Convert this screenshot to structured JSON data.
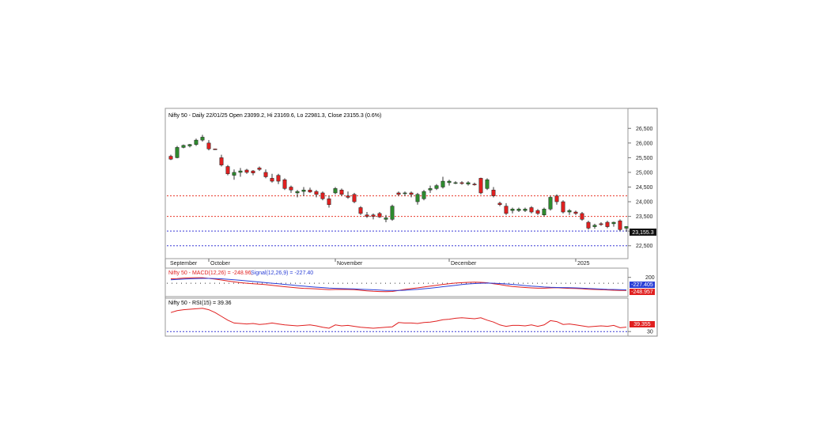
{
  "chart_data": [
    {
      "type": "candlestick",
      "title": "Nifty 50 - Daily 22/01/25 Open 23099.2, Hi 23169.6, Lo 22981.3, Close 23155.3 (0.6%)",
      "last_price_label": "23,155.3",
      "y_ticks": [
        {
          "value": 26500,
          "label": "26,500"
        },
        {
          "value": 26000,
          "label": "26,000"
        },
        {
          "value": 25500,
          "label": "25,500"
        },
        {
          "value": 25000,
          "label": "25,000"
        },
        {
          "value": 24500,
          "label": "24,500"
        },
        {
          "value": 24000,
          "label": "24,000"
        },
        {
          "value": 23500,
          "label": "23,500"
        },
        {
          "value": 23000,
          "label": "23,000"
        },
        {
          "value": 22500,
          "label": "22,500"
        }
      ],
      "ylim": [
        22250,
        26750
      ],
      "horizontal_lines": [
        {
          "value": 24200,
          "color": "#e8392b"
        },
        {
          "value": 23500,
          "color": "#e8392b"
        },
        {
          "value": 23000,
          "color": "#3a3ad6"
        },
        {
          "value": 22500,
          "color": "#3a3ad6"
        }
      ],
      "x_labels": [
        {
          "index": 0,
          "label": "September"
        },
        {
          "index": 6,
          "label": "October"
        },
        {
          "index": 26,
          "label": "November"
        },
        {
          "index": 44,
          "label": "December"
        },
        {
          "index": 64,
          "label": "2025"
        }
      ],
      "bullish_color": "#2e8b2e",
      "bearish_color": "#e02020",
      "candles": [
        {
          "o": 25550,
          "h": 25600,
          "l": 25420,
          "c": 25450
        },
        {
          "o": 25500,
          "h": 25900,
          "l": 25480,
          "c": 25850
        },
        {
          "o": 25850,
          "h": 25950,
          "l": 25820,
          "c": 25920
        },
        {
          "o": 25900,
          "h": 25970,
          "l": 25850,
          "c": 25950
        },
        {
          "o": 25950,
          "h": 26150,
          "l": 25900,
          "c": 26100
        },
        {
          "o": 26100,
          "h": 26280,
          "l": 26050,
          "c": 26200
        },
        {
          "o": 26000,
          "h": 26100,
          "l": 25750,
          "c": 25800
        },
        {
          "o": 25800,
          "h": 25810,
          "l": 25790,
          "c": 25796
        },
        {
          "o": 25500,
          "h": 25600,
          "l": 25200,
          "c": 25250
        },
        {
          "o": 25200,
          "h": 25250,
          "l": 24900,
          "c": 24950
        },
        {
          "o": 24900,
          "h": 25100,
          "l": 24750,
          "c": 25000
        },
        {
          "o": 25000,
          "h": 25150,
          "l": 24850,
          "c": 25050
        },
        {
          "o": 25080,
          "h": 25120,
          "l": 24950,
          "c": 25000
        },
        {
          "o": 25050,
          "h": 25080,
          "l": 24900,
          "c": 24980
        },
        {
          "o": 25150,
          "h": 25200,
          "l": 25050,
          "c": 25100
        },
        {
          "o": 25000,
          "h": 25100,
          "l": 24800,
          "c": 24850
        },
        {
          "o": 24800,
          "h": 24950,
          "l": 24650,
          "c": 24700
        },
        {
          "o": 24900,
          "h": 24950,
          "l": 24600,
          "c": 24700
        },
        {
          "o": 24750,
          "h": 24800,
          "l": 24400,
          "c": 24450
        },
        {
          "o": 24500,
          "h": 24550,
          "l": 24300,
          "c": 24400
        },
        {
          "o": 24300,
          "h": 24400,
          "l": 24150,
          "c": 24350
        },
        {
          "o": 24350,
          "h": 24500,
          "l": 24200,
          "c": 24400
        },
        {
          "o": 24400,
          "h": 24480,
          "l": 24300,
          "c": 24330
        },
        {
          "o": 24350,
          "h": 24400,
          "l": 24150,
          "c": 24250
        },
        {
          "o": 24300,
          "h": 24350,
          "l": 24050,
          "c": 24100
        },
        {
          "o": 24100,
          "h": 24200,
          "l": 23800,
          "c": 23900
        },
        {
          "o": 24300,
          "h": 24500,
          "l": 24250,
          "c": 24450
        },
        {
          "o": 24400,
          "h": 24450,
          "l": 24200,
          "c": 24250
        },
        {
          "o": 24200,
          "h": 24350,
          "l": 24100,
          "c": 24150
        },
        {
          "o": 24250,
          "h": 24300,
          "l": 23950,
          "c": 24000
        },
        {
          "o": 23800,
          "h": 23850,
          "l": 23550,
          "c": 23600
        },
        {
          "o": 23550,
          "h": 23650,
          "l": 23450,
          "c": 23500
        },
        {
          "o": 23550,
          "h": 23600,
          "l": 23400,
          "c": 23500
        },
        {
          "o": 23600,
          "h": 23650,
          "l": 23450,
          "c": 23480
        },
        {
          "o": 23400,
          "h": 23550,
          "l": 23300,
          "c": 23450
        },
        {
          "o": 23400,
          "h": 23900,
          "l": 23350,
          "c": 23850
        },
        {
          "o": 24300,
          "h": 24350,
          "l": 24200,
          "c": 24250
        },
        {
          "o": 24280,
          "h": 24350,
          "l": 24200,
          "c": 24300
        },
        {
          "o": 24300,
          "h": 24350,
          "l": 24150,
          "c": 24250
        },
        {
          "o": 24000,
          "h": 24300,
          "l": 23900,
          "c": 24250
        },
        {
          "o": 24100,
          "h": 24400,
          "l": 24050,
          "c": 24350
        },
        {
          "o": 24400,
          "h": 24550,
          "l": 24300,
          "c": 24450
        },
        {
          "o": 24450,
          "h": 24600,
          "l": 24400,
          "c": 24550
        },
        {
          "o": 24500,
          "h": 24850,
          "l": 24450,
          "c": 24700
        },
        {
          "o": 24650,
          "h": 24750,
          "l": 24550,
          "c": 24700
        },
        {
          "o": 24650,
          "h": 24700,
          "l": 24600,
          "c": 24650
        },
        {
          "o": 24650,
          "h": 24700,
          "l": 24580,
          "c": 24620
        },
        {
          "o": 24600,
          "h": 24700,
          "l": 24550,
          "c": 24650
        },
        {
          "o": 24600,
          "h": 24650,
          "l": 24550,
          "c": 24580
        },
        {
          "o": 24800,
          "h": 24820,
          "l": 24250,
          "c": 24300
        },
        {
          "o": 24450,
          "h": 24800,
          "l": 24400,
          "c": 24750
        },
        {
          "o": 24400,
          "h": 24500,
          "l": 24150,
          "c": 24200
        },
        {
          "o": 23950,
          "h": 24000,
          "l": 23850,
          "c": 23900
        },
        {
          "o": 23850,
          "h": 23950,
          "l": 23550,
          "c": 23600
        },
        {
          "o": 23700,
          "h": 23800,
          "l": 23600,
          "c": 23750
        },
        {
          "o": 23700,
          "h": 23800,
          "l": 23650,
          "c": 23750
        },
        {
          "o": 23700,
          "h": 23800,
          "l": 23650,
          "c": 23750
        },
        {
          "o": 23800,
          "h": 23850,
          "l": 23600,
          "c": 23650
        },
        {
          "o": 23700,
          "h": 23750,
          "l": 23550,
          "c": 23600
        },
        {
          "o": 23550,
          "h": 23800,
          "l": 23500,
          "c": 23750
        },
        {
          "o": 23750,
          "h": 24200,
          "l": 23700,
          "c": 24150
        },
        {
          "o": 24200,
          "h": 24250,
          "l": 23900,
          "c": 24000
        },
        {
          "o": 24000,
          "h": 24050,
          "l": 23600,
          "c": 23650
        },
        {
          "o": 23650,
          "h": 23750,
          "l": 23550,
          "c": 23700
        },
        {
          "o": 23650,
          "h": 23700,
          "l": 23550,
          "c": 23600
        },
        {
          "o": 23600,
          "h": 23650,
          "l": 23350,
          "c": 23400
        },
        {
          "o": 23300,
          "h": 23350,
          "l": 23050,
          "c": 23100
        },
        {
          "o": 23150,
          "h": 23250,
          "l": 23080,
          "c": 23200
        },
        {
          "o": 23250,
          "h": 23300,
          "l": 23180,
          "c": 23220
        },
        {
          "o": 23300,
          "h": 23350,
          "l": 23100,
          "c": 23150
        },
        {
          "o": 23250,
          "h": 23320,
          "l": 23150,
          "c": 23300
        },
        {
          "o": 23350,
          "h": 23400,
          "l": 23000,
          "c": 23050
        },
        {
          "o": 23099.2,
          "h": 23169.6,
          "l": 22981.3,
          "c": 23155.3
        }
      ]
    },
    {
      "type": "line",
      "title": "Nifty 50 - MACD(12,26) = -248.96, Signal(12,26,9) = -227.40",
      "title_parts": {
        "macd": "Nifty 50 - MACD(12,26) = -248.96,",
        "signal": "Signal(12,26,9) = -227.40"
      },
      "y_ticks": [
        {
          "value": 200,
          "label": "200"
        }
      ],
      "ylim": [
        -430,
        300
      ],
      "value_labels": [
        "-227.405",
        "-248.957"
      ],
      "series": [
        {
          "name": "MACD(12,26)",
          "color": "#e02020",
          "values": [
            150,
            160,
            175,
            185,
            190,
            190,
            165,
            140,
            110,
            75,
            45,
            20,
            0,
            -15,
            -30,
            -50,
            -70,
            -95,
            -120,
            -140,
            -160,
            -175,
            -185,
            -195,
            -205,
            -220,
            -215,
            -210,
            -215,
            -220,
            -240,
            -260,
            -275,
            -285,
            -290,
            -280,
            -245,
            -210,
            -185,
            -160,
            -130,
            -100,
            -70,
            -40,
            -15,
            5,
            20,
            30,
            35,
            30,
            15,
            -15,
            -45,
            -80,
            -110,
            -130,
            -145,
            -160,
            -170,
            -170,
            -160,
            -155,
            -165,
            -175,
            -180,
            -190,
            -205,
            -215,
            -220,
            -230,
            -240,
            -245,
            -249
          ]
        },
        {
          "name": "Signal(12,26,9)",
          "color": "#2a3ed6",
          "values": [
            120,
            130,
            140,
            150,
            158,
            165,
            165,
            160,
            150,
            135,
            120,
            100,
            80,
            60,
            40,
            20,
            0,
            -20,
            -40,
            -60,
            -80,
            -100,
            -120,
            -135,
            -150,
            -165,
            -175,
            -185,
            -190,
            -195,
            -205,
            -215,
            -225,
            -235,
            -245,
            -250,
            -250,
            -240,
            -225,
            -210,
            -190,
            -170,
            -145,
            -120,
            -95,
            -70,
            -45,
            -25,
            -10,
            0,
            5,
            0,
            -10,
            -25,
            -40,
            -60,
            -80,
            -100,
            -115,
            -130,
            -140,
            -145,
            -150,
            -155,
            -160,
            -170,
            -180,
            -190,
            -200,
            -210,
            -215,
            -222,
            -227
          ]
        }
      ]
    },
    {
      "type": "line",
      "title": "Nifty 50 - RSI(15) = 39.36",
      "y_ticks": [
        {
          "value": 30,
          "label": "30"
        }
      ],
      "ylim": [
        27,
        82
      ],
      "horizontal_lines": [
        {
          "value": 30,
          "color": "#3a3ad6"
        }
      ],
      "value_label": "39.355",
      "series": [
        {
          "name": "RSI(15)",
          "color": "#e02020",
          "values": [
            70,
            74,
            76,
            77,
            78,
            79,
            76,
            70,
            62,
            54,
            48,
            47,
            46,
            47,
            45,
            46,
            48,
            46,
            44,
            43,
            42,
            43,
            44,
            42,
            39,
            37,
            44,
            42,
            43,
            41,
            39,
            38,
            37,
            38,
            39,
            40,
            49,
            48,
            48,
            47,
            49,
            50,
            52,
            55,
            56,
            58,
            59,
            58,
            57,
            59,
            54,
            50,
            44,
            41,
            43,
            43,
            42,
            44,
            41,
            44,
            53,
            51,
            45,
            46,
            44,
            42,
            40,
            41,
            42,
            41,
            43,
            38,
            39.36
          ]
        }
      ]
    }
  ]
}
